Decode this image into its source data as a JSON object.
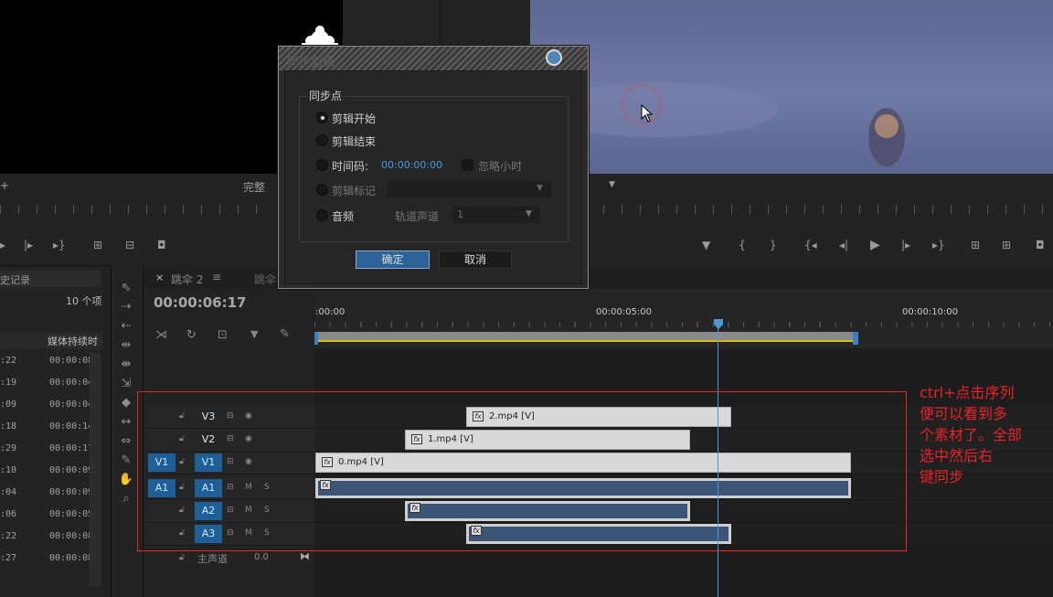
{
  "source_monitor": {
    "fit_label": "完整"
  },
  "project_panel": {
    "tab_label": "史记录",
    "item_count": "10 个项",
    "column_header": "媒体持续时",
    "rows": [
      {
        "name": ":22",
        "duration": "00:00:08"
      },
      {
        "name": ":19",
        "duration": "00:00:04"
      },
      {
        "name": ":09",
        "duration": "00:00:04"
      },
      {
        "name": ":18",
        "duration": "00:00:14"
      },
      {
        "name": ":29",
        "duration": "00:00:17"
      },
      {
        "name": ":10",
        "duration": "00:00:09"
      },
      {
        "name": ":04",
        "duration": "00:00:09"
      },
      {
        "name": ":06",
        "duration": "00:00:05"
      },
      {
        "name": ":22",
        "duration": "00:00:08"
      },
      {
        "name": ":27",
        "duration": "00:00:08"
      }
    ]
  },
  "timeline": {
    "tab_active": "跳伞 2",
    "tab_inactive": "跳伞",
    "timecode": "00:00:06:17",
    "ruler_labels": [
      ":00:00",
      "00:00:05:00",
      "00:00:10:00"
    ],
    "playhead_seconds": 6.57,
    "video_tracks": [
      {
        "src": "",
        "name": "V3",
        "clip": "2.mp4 [V]"
      },
      {
        "src": "",
        "name": "V2",
        "clip": "1.mp4 [V]"
      },
      {
        "src": "V1",
        "name": "V1",
        "clip": "0.mp4 [V]"
      }
    ],
    "audio_tracks": [
      {
        "src": "A1",
        "name": "A1",
        "m": "M",
        "s": "S"
      },
      {
        "src": "",
        "name": "A2",
        "m": "M",
        "s": "S"
      },
      {
        "src": "",
        "name": "A3",
        "m": "M",
        "s": "S"
      }
    ],
    "master": {
      "label": "主声道",
      "value": "0.0"
    }
  },
  "dialog": {
    "title": "同步剪辑",
    "group_label": "同步点",
    "options": {
      "clip_start": "剪辑开始",
      "clip_end": "剪辑结束",
      "timecode": "时间码:",
      "timecode_value": "00:00:00:00",
      "ignore_hours": "忽略小时",
      "clip_marker": "剪辑标记",
      "audio": "音频",
      "track_channel": "轨道声道",
      "track_channel_value": "1"
    },
    "selected_option": "clip_start",
    "ok": "确定",
    "cancel": "取消"
  },
  "annotation": {
    "lines": [
      "ctrl+点击序列",
      "便可以看到多",
      "个素材了。全部",
      "选中然后右",
      "键同步"
    ],
    "color": "#e8232a"
  },
  "colors": {
    "accent": "#1d5f96",
    "clip_video": "#d9d9d9",
    "clip_audio": "#3c5576",
    "playhead": "#4a9ad8"
  }
}
